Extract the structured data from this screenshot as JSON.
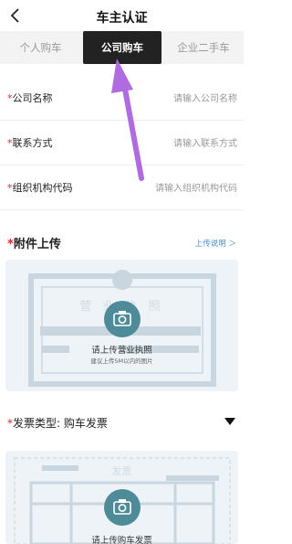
{
  "header": {
    "title": "车主认证"
  },
  "tabs": [
    {
      "label": "个人购车",
      "active": false
    },
    {
      "label": "公司购车",
      "active": true
    },
    {
      "label": "企业二手车",
      "active": false
    }
  ],
  "form": {
    "required_mark": "*",
    "company_name": {
      "label": "公司名称",
      "placeholder": "请输入公司名称"
    },
    "contact": {
      "label": "联系方式",
      "placeholder": "请输入联系方式"
    },
    "org_code": {
      "label": "组织机构代码",
      "placeholder": "请输入组织机构代码"
    }
  },
  "attachments": {
    "title": "附件上传",
    "help_link": "上传说明 ＞",
    "license": {
      "watermark": "营 业 执 照",
      "label": "请上传营业执照",
      "hint": "建议上传5M以内的图片"
    },
    "invoice": {
      "type_label": "发票类型:",
      "type_value": "购车发票",
      "watermark": "发票",
      "label": "请上传购车发票"
    }
  },
  "colors": {
    "required": "#d9282f",
    "active_tab_bg": "#222222",
    "camera_circle": "#4e8b99",
    "annotation_arrow": "#b06be0",
    "link": "#4a90c8"
  },
  "icons": {
    "back": "chevron-left-icon",
    "camera": "camera-icon",
    "dropdown": "triangle-down-icon"
  }
}
